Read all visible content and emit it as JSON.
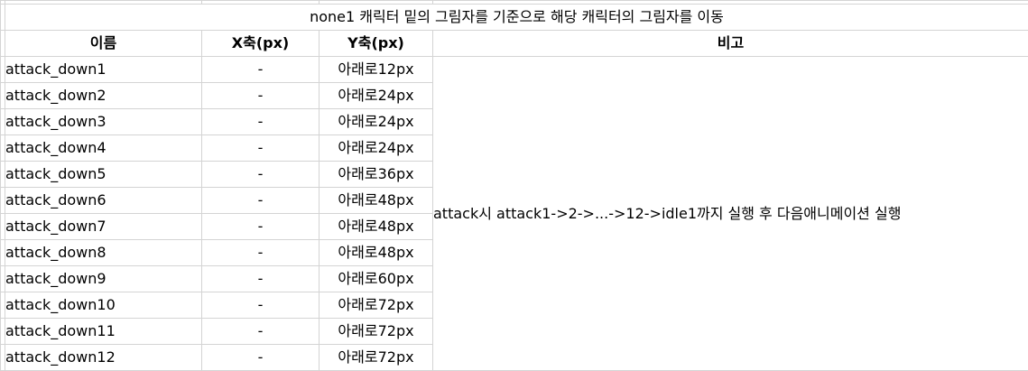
{
  "title": "none1 캐릭터 밑의 그림자를 기준으로  해당 캐릭터의 그림자를 이동",
  "headers": {
    "name": "이름",
    "x": "X축(px)",
    "y": "Y축(px)",
    "note": "비고"
  },
  "rows": [
    {
      "name": "attack_down1",
      "x": "-",
      "y": "아래로12px"
    },
    {
      "name": "attack_down2",
      "x": "-",
      "y": "아래로24px"
    },
    {
      "name": "attack_down3",
      "x": "-",
      "y": "아래로24px"
    },
    {
      "name": "attack_down4",
      "x": "-",
      "y": "아래로24px"
    },
    {
      "name": "attack_down5",
      "x": "-",
      "y": "아래로36px"
    },
    {
      "name": "attack_down6",
      "x": "-",
      "y": "아래로48px"
    },
    {
      "name": "attack_down7",
      "x": "-",
      "y": "아래로48px"
    },
    {
      "name": "attack_down8",
      "x": "-",
      "y": "아래로48px"
    },
    {
      "name": "attack_down9",
      "x": "-",
      "y": "아래로60px"
    },
    {
      "name": "attack_down10",
      "x": "-",
      "y": "아래로72px"
    },
    {
      "name": "attack_down11",
      "x": "-",
      "y": "아래로72px"
    },
    {
      "name": "attack_down12",
      "x": "-",
      "y": "아래로72px"
    }
  ],
  "note": "attack시 attack1->2->...->12->idle1까지 실행 후 다음애니메이션 실행"
}
